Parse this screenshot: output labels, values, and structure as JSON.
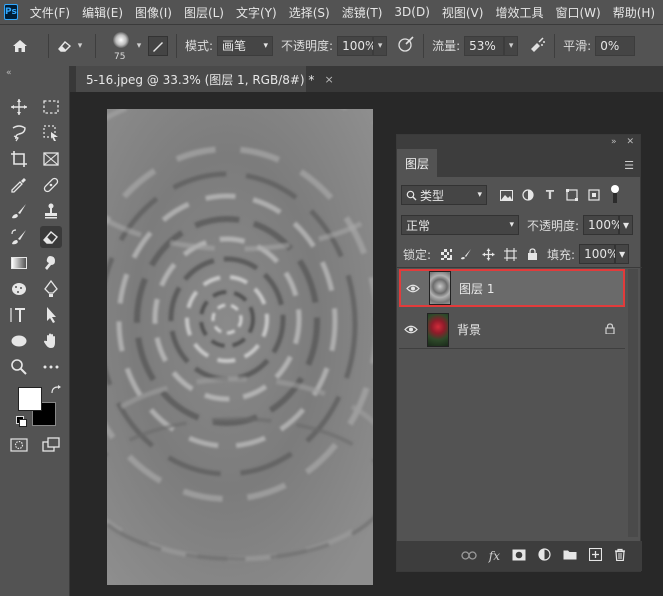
{
  "app": {
    "logo": "Ps"
  },
  "menu": [
    "文件(F)",
    "编辑(E)",
    "图像(I)",
    "图层(L)",
    "文字(Y)",
    "选择(S)",
    "滤镜(T)",
    "3D(D)",
    "视图(V)",
    "增效工具",
    "窗口(W)",
    "帮助(H)"
  ],
  "options": {
    "brush_size": "75",
    "mode_label": "模式:",
    "mode_value": "画笔",
    "opacity_label": "不透明度:",
    "opacity_value": "100%",
    "flow_label": "流量:",
    "flow_value": "53%",
    "smoothing_label": "平滑:",
    "smoothing_value": "0%"
  },
  "document": {
    "tab_label": "5-16.jpeg @ 33.3% (图层 1, RGB/8#) *",
    "close_glyph": "×"
  },
  "layers_panel": {
    "tab_label": "图层",
    "filter_kind": "类型",
    "blend_mode": "正常",
    "opacity_label": "不透明度:",
    "opacity_value": "100%",
    "lock_label": "锁定:",
    "fill_label": "填充:",
    "fill_value": "100%",
    "layers": [
      {
        "name": "图层 1",
        "selected": true
      },
      {
        "name": "背景",
        "locked": true
      }
    ]
  },
  "colors": {
    "foreground": "#ffffff",
    "background": "#000000",
    "selection_outline": "#e23b3b"
  }
}
